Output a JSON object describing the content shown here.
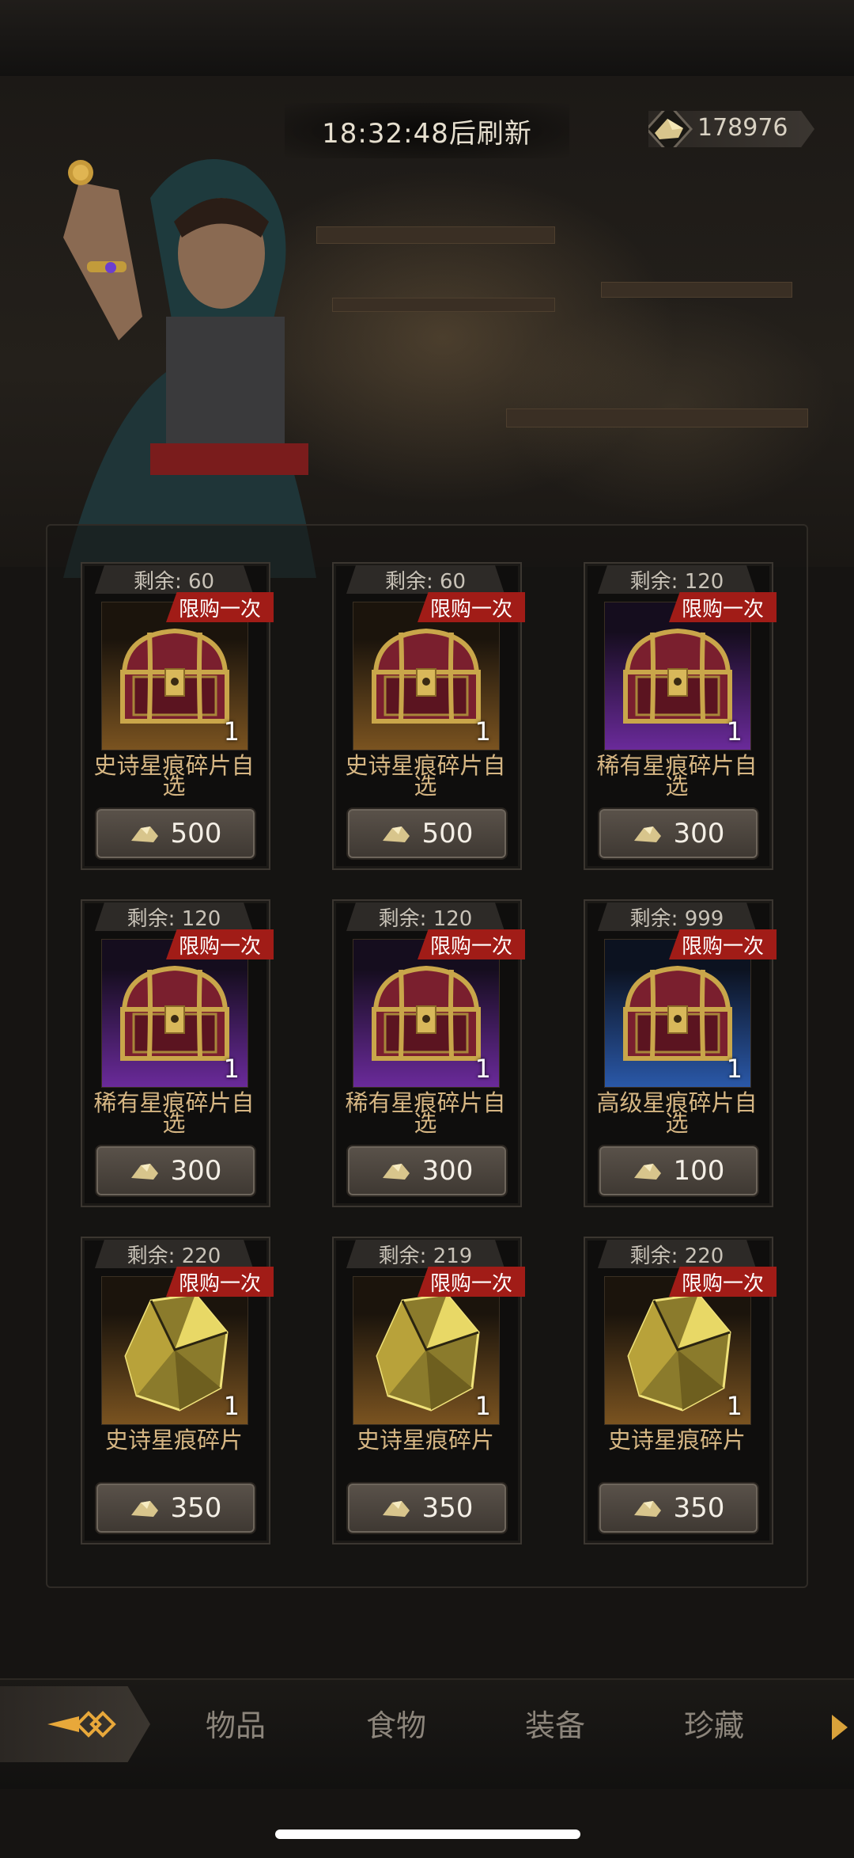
{
  "header": {
    "refresh_timer": "18:32:48后刷新",
    "currency_amount": "178976"
  },
  "shop_items": [
    {
      "remaining": "剩余: 60",
      "badge": "限购一次",
      "quantity": "1",
      "name": "史诗星痕碎片自选",
      "price": "500",
      "rarity_color": "gold",
      "item_icon": "chest-icon"
    },
    {
      "remaining": "剩余: 60",
      "badge": "限购一次",
      "quantity": "1",
      "name": "史诗星痕碎片自选",
      "price": "500",
      "rarity_color": "gold",
      "item_icon": "chest-icon"
    },
    {
      "remaining": "剩余: 120",
      "badge": "限购一次",
      "quantity": "1",
      "name": "稀有星痕碎片自选",
      "price": "300",
      "rarity_color": "purple",
      "item_icon": "chest-icon"
    },
    {
      "remaining": "剩余: 120",
      "badge": "限购一次",
      "quantity": "1",
      "name": "稀有星痕碎片自选",
      "price": "300",
      "rarity_color": "purple",
      "item_icon": "chest-icon"
    },
    {
      "remaining": "剩余: 120",
      "badge": "限购一次",
      "quantity": "1",
      "name": "稀有星痕碎片自选",
      "price": "300",
      "rarity_color": "purple",
      "item_icon": "chest-icon"
    },
    {
      "remaining": "剩余: 999",
      "badge": "限购一次",
      "quantity": "1",
      "name": "高级星痕碎片自选",
      "price": "100",
      "rarity_color": "blue",
      "item_icon": "chest-icon"
    },
    {
      "remaining": "剩余: 220",
      "badge": "限购一次",
      "quantity": "1",
      "name": "史诗星痕碎片",
      "price": "350",
      "rarity_color": "gold",
      "item_icon": "crystal-shard-icon"
    },
    {
      "remaining": "剩余: 219",
      "badge": "限购一次",
      "quantity": "1",
      "name": "史诗星痕碎片",
      "price": "350",
      "rarity_color": "gold",
      "item_icon": "crystal-shard-icon"
    },
    {
      "remaining": "剩余: 220",
      "badge": "限购一次",
      "quantity": "1",
      "name": "史诗星痕碎片",
      "price": "350",
      "rarity_color": "gold",
      "item_icon": "crystal-shard-icon"
    }
  ],
  "tabs": [
    {
      "label": "物品"
    },
    {
      "label": "食物"
    },
    {
      "label": "装备"
    },
    {
      "label": "珍藏"
    }
  ],
  "colors": {
    "limit_badge": "#a11c17",
    "item_name": "#d6b683",
    "gold_bg": "#7a5320",
    "purple_bg": "#6a2a9a",
    "blue_bg": "#2a58a8"
  }
}
